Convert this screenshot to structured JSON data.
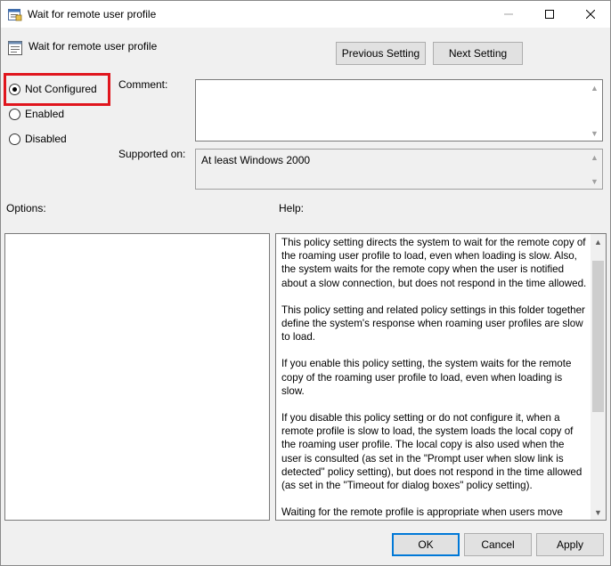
{
  "window": {
    "title": "Wait for remote user profile"
  },
  "header": {
    "title": "Wait for remote user profile",
    "previous_label": "Previous Setting",
    "next_label": "Next Setting"
  },
  "state": {
    "options": [
      {
        "label": "Not Configured",
        "selected": true
      },
      {
        "label": "Enabled",
        "selected": false
      },
      {
        "label": "Disabled",
        "selected": false
      }
    ]
  },
  "fields": {
    "comment_label": "Comment:",
    "comment_value": "",
    "supported_label": "Supported on:",
    "supported_value": "At least Windows 2000"
  },
  "panels": {
    "options_label": "Options:",
    "help_label": "Help:",
    "help_paragraphs": [
      "This policy setting directs the system to wait for the remote copy of the roaming user profile to load, even when loading is slow. Also, the system waits for the remote copy when the user is notified about a slow connection, but does not respond in the time allowed.",
      "This policy setting and related policy settings in this folder together define the system's response when roaming user profiles are slow to load.",
      "If you enable this policy setting, the system waits for the remote copy of the roaming user profile to load, even when loading is slow.",
      "If you disable this policy setting or do not configure it, when a remote profile is slow to load, the system loads the local copy of the roaming user profile. The local copy is also used when the user is consulted (as set in the \"Prompt user when slow link is detected\" policy setting), but does not respond in the time allowed (as set in the \"Timeout for dialog boxes\" policy setting).",
      "Waiting for the remote profile is appropriate when users move"
    ]
  },
  "footer": {
    "ok_label": "OK",
    "cancel_label": "Cancel",
    "apply_label": "Apply"
  },
  "icons": {
    "title": "policy-icon",
    "minimize": "minimize-icon",
    "maximize": "maximize-icon",
    "close": "close-icon",
    "header": "setting-icon"
  },
  "colors": {
    "highlight": "#e0151d",
    "default_button_border": "#0078d7"
  }
}
